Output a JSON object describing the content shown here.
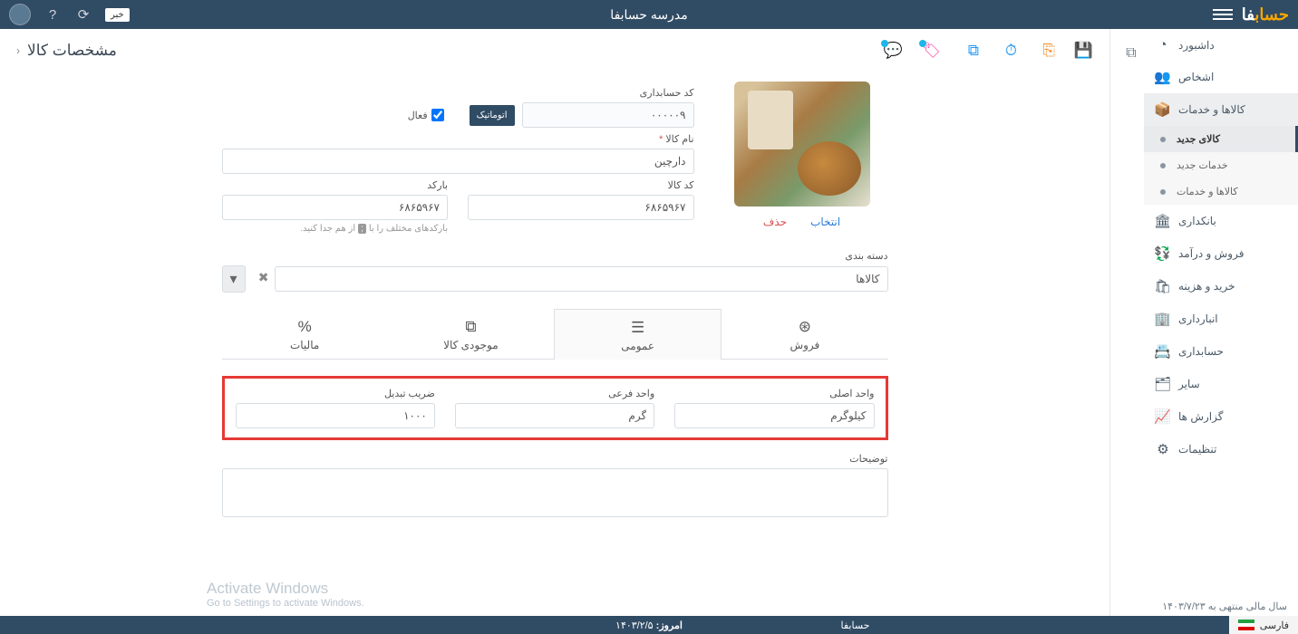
{
  "topbar": {
    "logo_orange": "حساب",
    "logo_white": "فا",
    "app_title": "مدرسه حسابفا",
    "news_btn": "خبر"
  },
  "sidebar": {
    "items": [
      {
        "label": "داشبورد",
        "icon": "◔"
      },
      {
        "label": "اشخاص",
        "icon": "👥"
      },
      {
        "label": "کالاها و خدمات",
        "icon": "📦",
        "active": true
      },
      {
        "label": "بانکداری",
        "icon": "🏛"
      },
      {
        "label": "فروش و درآمد",
        "icon": "💱"
      },
      {
        "label": "خرید و هزینه",
        "icon": "🛍"
      },
      {
        "label": "انبارداری",
        "icon": "🏢"
      },
      {
        "label": "حسابداری",
        "icon": "📇"
      },
      {
        "label": "سایر",
        "icon": "🗂"
      },
      {
        "label": "گزارش ها",
        "icon": "📈"
      },
      {
        "label": "تنظیمات",
        "icon": "⚙"
      }
    ],
    "sub": [
      {
        "label": "کالای جدید",
        "sel": true
      },
      {
        "label": "خدمات جدید"
      },
      {
        "label": "کالاها و خدمات"
      }
    ]
  },
  "actionbar": {
    "page_title": "مشخصات کالا"
  },
  "form": {
    "acc_code_label": "کد حسابداری",
    "acc_code": "۰۰۰۰۰۹",
    "auto_btn": "اتوماتیک",
    "active_label": "فعال",
    "name_label": "نام کالا",
    "name": "دارچین",
    "code_label": "کد کالا",
    "code": "۶۸۶۵۹۶۷",
    "barcode_label": "بارکد",
    "barcode": "۶۸۶۵۹۶۷",
    "barcode_hint_before": "بارکدهای مختلف را با",
    "barcode_hint_box": ";",
    "barcode_hint_after": "از هم جدا کنید.",
    "category_label": "دسته بندی",
    "category": "کالاها",
    "img_select": "انتخاب",
    "img_delete": "حذف"
  },
  "tabs": [
    {
      "label": "فروش",
      "icon": "$"
    },
    {
      "label": "عمومی",
      "icon": "☰",
      "active": true
    },
    {
      "label": "موجودی کالا",
      "icon": "⧉"
    },
    {
      "label": "مالیات",
      "icon": "%"
    }
  ],
  "units": {
    "main_label": "واحد اصلی",
    "main": "کیلوگرم",
    "sub_label": "واحد فرعی",
    "sub": "گرم",
    "factor_label": "ضریب تبدیل",
    "factor": "۱۰۰۰"
  },
  "desc_label": "توضیحات",
  "watermark": {
    "line1": "Activate Windows",
    "line2": "Go to Settings to activate Windows."
  },
  "fiscal": "سال مالی منتهی به ۱۴۰۳/۷/۲۳",
  "footer": {
    "brand": "حسابفا",
    "today_label": "امروز:",
    "today": "۱۴۰۳/۲/۵",
    "lang": "فارسی"
  }
}
